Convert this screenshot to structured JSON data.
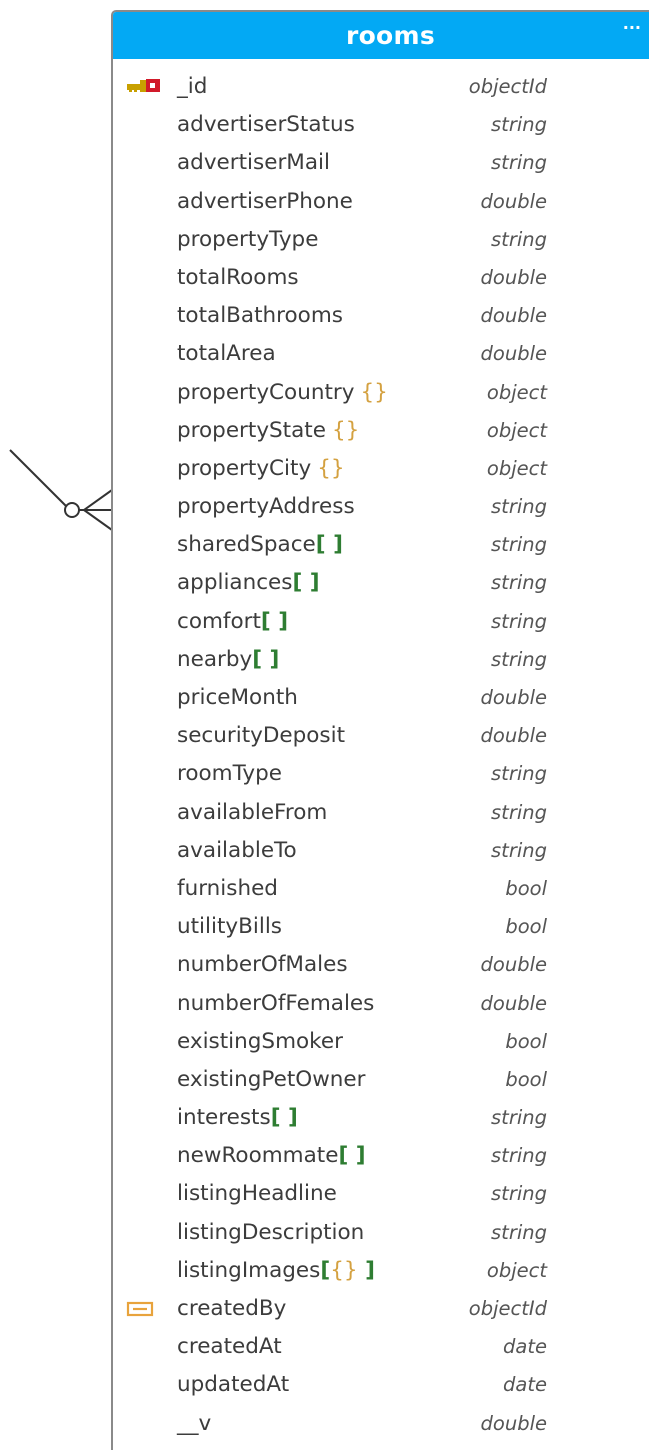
{
  "entity": {
    "title": "rooms",
    "menu": "···"
  },
  "fields": [
    {
      "name": "_id",
      "suffix": "",
      "type": "objectId",
      "icon": "primary-key-icon"
    },
    {
      "name": "advertiserStatus",
      "suffix": "",
      "type": "string",
      "icon": ""
    },
    {
      "name": "advertiserMail",
      "suffix": "",
      "type": "string",
      "icon": ""
    },
    {
      "name": "advertiserPhone",
      "suffix": "",
      "type": "double",
      "icon": ""
    },
    {
      "name": "propertyType",
      "suffix": "",
      "type": "string",
      "icon": ""
    },
    {
      "name": "totalRooms",
      "suffix": "",
      "type": "double",
      "icon": ""
    },
    {
      "name": "totalBathrooms",
      "suffix": "",
      "type": "double",
      "icon": ""
    },
    {
      "name": "totalArea",
      "suffix": "",
      "type": "double",
      "icon": ""
    },
    {
      "name": "propertyCountry",
      "suffix": "{}",
      "type": "object",
      "icon": ""
    },
    {
      "name": "propertyState",
      "suffix": "{}",
      "type": "object",
      "icon": ""
    },
    {
      "name": "propertyCity",
      "suffix": "{}",
      "type": "object",
      "icon": ""
    },
    {
      "name": "propertyAddress",
      "suffix": "",
      "type": "string",
      "icon": ""
    },
    {
      "name": "sharedSpace",
      "suffix": "[ ]",
      "type": "string",
      "icon": ""
    },
    {
      "name": "appliances",
      "suffix": "[ ]",
      "type": "string",
      "icon": ""
    },
    {
      "name": "comfort",
      "suffix": "[ ]",
      "type": "string",
      "icon": ""
    },
    {
      "name": "nearby",
      "suffix": "[ ]",
      "type": "string",
      "icon": ""
    },
    {
      "name": "priceMonth",
      "suffix": "",
      "type": "double",
      "icon": ""
    },
    {
      "name": "securityDeposit",
      "suffix": "",
      "type": "double",
      "icon": ""
    },
    {
      "name": "roomType",
      "suffix": "",
      "type": "string",
      "icon": ""
    },
    {
      "name": "availableFrom",
      "suffix": "",
      "type": "string",
      "icon": ""
    },
    {
      "name": "availableTo",
      "suffix": "",
      "type": "string",
      "icon": ""
    },
    {
      "name": "furnished",
      "suffix": "",
      "type": "bool",
      "icon": ""
    },
    {
      "name": "utilityBills",
      "suffix": "",
      "type": "bool",
      "icon": ""
    },
    {
      "name": "numberOfMales",
      "suffix": "",
      "type": "double",
      "icon": ""
    },
    {
      "name": "numberOfFemales",
      "suffix": "",
      "type": "double",
      "icon": ""
    },
    {
      "name": "existingSmoker",
      "suffix": "",
      "type": "bool",
      "icon": ""
    },
    {
      "name": "existingPetOwner",
      "suffix": "",
      "type": "bool",
      "icon": ""
    },
    {
      "name": "interests",
      "suffix": "[ ]",
      "type": "string",
      "icon": ""
    },
    {
      "name": "newRoommate",
      "suffix": "[ ]",
      "type": "string",
      "icon": ""
    },
    {
      "name": "listingHeadline",
      "suffix": "",
      "type": "string",
      "icon": ""
    },
    {
      "name": "listingDescription",
      "suffix": "",
      "type": "string",
      "icon": ""
    },
    {
      "name": "listingImages",
      "suffix": "[{} ]",
      "type": "object",
      "icon": ""
    },
    {
      "name": "createdBy",
      "suffix": "",
      "type": "objectId",
      "icon": "foreign-key-icon"
    },
    {
      "name": "createdAt",
      "suffix": "",
      "type": "date",
      "icon": ""
    },
    {
      "name": "updatedAt",
      "suffix": "",
      "type": "date",
      "icon": ""
    },
    {
      "name": "__v",
      "suffix": "",
      "type": "double",
      "icon": ""
    }
  ],
  "colors": {
    "header_bg": "#03a9f4",
    "header_text": "#ffffff",
    "object_brace": "#d4a140",
    "array_bracket": "#2e7d32"
  }
}
